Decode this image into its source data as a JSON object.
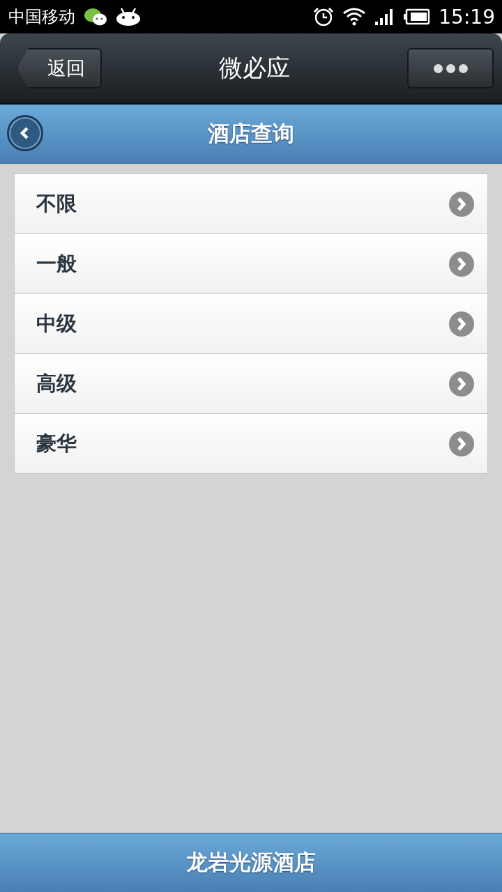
{
  "status_bar": {
    "carrier": "中国移动",
    "time": "15:19"
  },
  "nav_bar": {
    "back_label": "返回",
    "title": "微必应"
  },
  "header": {
    "title": "酒店查询"
  },
  "list": {
    "items": [
      {
        "label": "不限"
      },
      {
        "label": "一般"
      },
      {
        "label": "中级"
      },
      {
        "label": "高级"
      },
      {
        "label": "豪华"
      }
    ]
  },
  "footer": {
    "title": "龙岩光源酒店"
  }
}
